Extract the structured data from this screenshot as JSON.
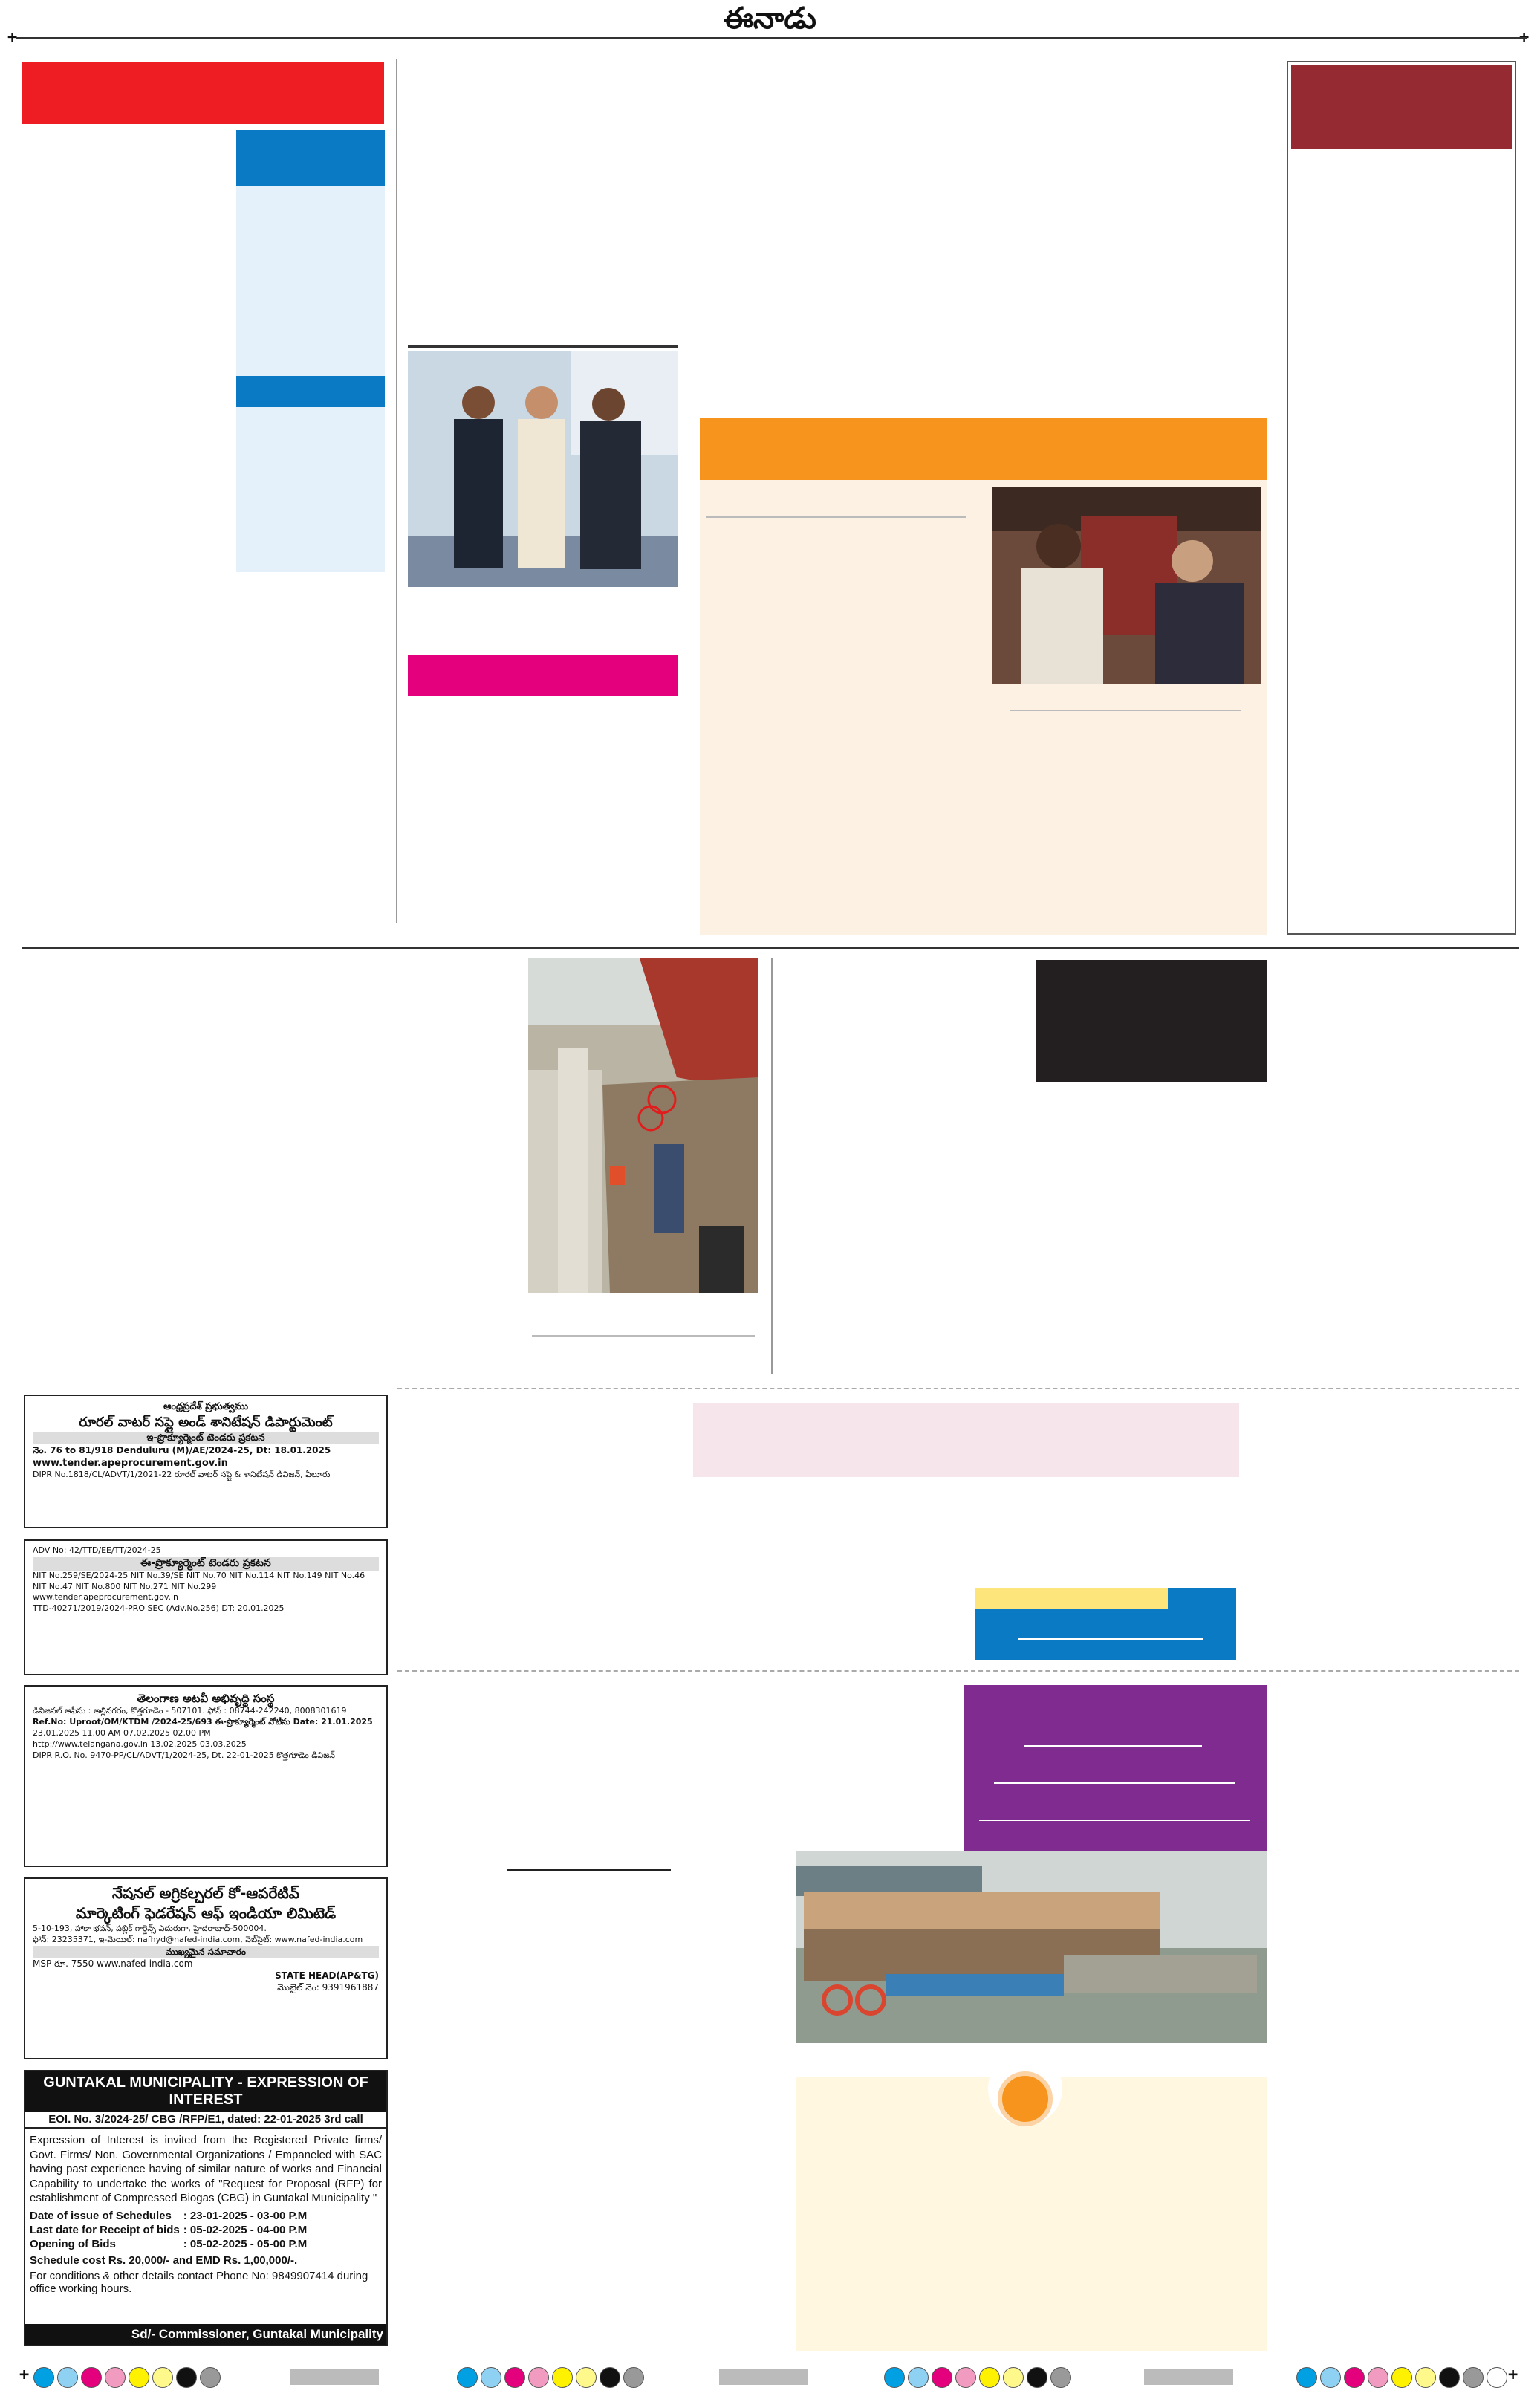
{
  "masthead": {
    "title": "ఈనాడు",
    "reg_mark": "+"
  },
  "ads": {
    "rwss": {
      "lines": [
        "ఆంధ్రప్రదేశ్ ప్రభుత్వము",
        "రూరల్ వాటర్ సప్లై అండ్ శానిటేషన్ డిపార్టుమెంట్",
        "ఇ-ప్రొక్యూర్మెంట్ టెండరు ప్రకటన",
        "నెం. 76 to 81/918 Denduluru (M)/AE/2024-25,   Dt: 18.01.2025",
        "www.tender.apeprocurement.gov.in",
        "DIPR No.1818/CL/ADVT/1/2021-22   రూరల్ వాటర్ సప్లై & శానిటేషన్ డివిజన్, ఏలూరు"
      ]
    },
    "ttd": {
      "lines": [
        "ADV No: 42/TTD/EE/TT/2024-25",
        "ఈ-ప్రొక్యూర్మెంట్ టెండరు ప్రకటన",
        "NIT No.259/SE/2024-25  NIT No.39/SE  NIT No.70  NIT No.114  NIT No.149  NIT No.46  NIT No.47  NIT No.800  NIT No.271  NIT No.299",
        "www.tender.apeprocurement.gov.in",
        "TTD-40271/2019/2024-PRO SEC (Adv.No.256)   DT: 20.01.2025"
      ]
    },
    "telangana": {
      "lines": [
        "తెలంగాణ అటవీ అభివృద్ధి సంస్థ",
        "డివిజనల్ ఆఫీసు : అల్లినగరం, కొత్తగూడెం - 507101.  ఫోన్ : 08744-242240, 8008301619",
        "Ref.No: Uproot/OM/KTDM /2024-25/693   ఈ-ప్రొక్యూర్మెంట్ నోటీసు   Date: 21.01.2025",
        "23.01.2025  11.00 AM  07.02.2025  02.00 PM",
        "http://www.telangana.gov.in   13.02.2025  03.03.2025",
        "DIPR R.O. No. 9470-PP/CL/ADVT/1/2024-25, Dt. 22-01-2025   కొత్తగూడెం డివిజన్"
      ]
    },
    "nafed": {
      "lines": [
        "నేషనల్ అగ్రికల్చరల్ కో-ఆపరేటివ్",
        "మార్కెటింగ్ ఫెడరేషన్ ఆఫ్ ఇండియా లిమిటెడ్",
        "5-10-193, హాకా భవన్, పబ్లిక్ గార్డెన్స్ ఎదురుగా, హైదరాబాద్-500004.",
        "ఫోన్: 23235371, ఇ-మెయిల్: nafhyd@nafed-india.com, వెబ్‌సైట్: www.nafed-india.com",
        "ముఖ్యమైన సమాచారం",
        "MSP  రూ. 7550  www.nafed-india.com",
        "STATE HEAD(AP&TG)",
        "మొబైల్ నెం: 9391961887"
      ]
    },
    "guntakal": {
      "title": "GUNTAKAL MUNICIPALITY - EXPRESSION OF INTEREST",
      "eoi": "EOI. No. 3/2024-25/ CBG /RFP/E1, dated: 22-01-2025  3rd call",
      "body": "Expression of Interest is invited from the Registered Private firms/ Govt. Firms/ Non. Governmental Organizations / Empaneled with SAC having past experience having of similar nature of works and Financial Capability to undertake the works of \"Request for Proposal (RFP) for establishment of Compressed Biogas (CBG) in Guntakal Municipality \"",
      "rows": [
        {
          "label": "Date of issue of Schedules",
          "value": ": 23-01-2025 - 03-00 P.M"
        },
        {
          "label": "Last date for Receipt of bids",
          "value": ": 05-02-2025 - 04-00 P.M"
        },
        {
          "label": "Opening of Bids",
          "value": ": 05-02-2025 - 05-00 P.M"
        }
      ],
      "cost": "Schedule cost Rs. 20,000/- and EMD Rs. 1,00,000/-.",
      "contact": "For conditions & other details contact Phone No: 9849907414 during office working hours.",
      "sign": "Sd/- Commissioner, Guntakal Municipality"
    }
  },
  "colors": {
    "red": "#ee1d24",
    "blue": "#0b7ac4",
    "light_blue": "#e4f1fb",
    "maroon": "#962a33",
    "orange": "#f7941d",
    "peach": "#fdf1e4",
    "magenta": "#e4007c",
    "pink_light": "#f6e6ec",
    "yellow": "#fde57b",
    "purple": "#7f2b8f",
    "cream": "#fff7df",
    "black_box": "#231f20"
  }
}
